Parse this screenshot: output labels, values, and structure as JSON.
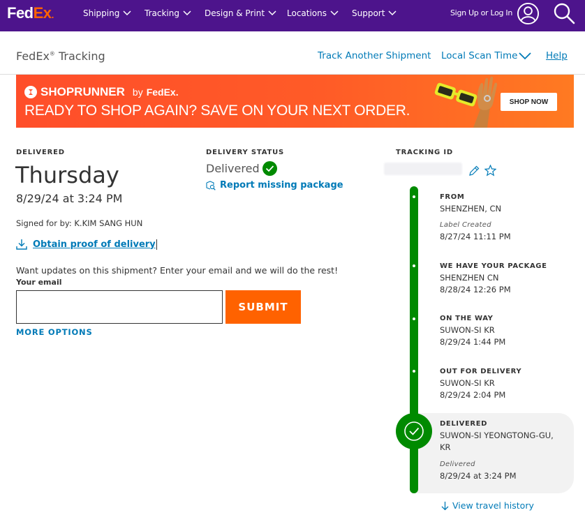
{
  "nav": {
    "logo_fed": "Fed",
    "logo_ex": "Ex",
    "items": [
      {
        "label": "Shipping"
      },
      {
        "label": "Tracking"
      },
      {
        "label": "Design & Print"
      },
      {
        "label": "Locations"
      },
      {
        "label": "Support"
      }
    ],
    "signup": "Sign Up or Log In"
  },
  "subheader": {
    "brand": "FedEx",
    "reg": "®",
    "page": "Tracking",
    "track_another": "Track Another Shipment",
    "local_scan_time": "Local Scan Time",
    "help": "Help"
  },
  "banner": {
    "brand": "SHOPRUNNER",
    "by": "by",
    "fedex": "FedEx.",
    "headline": "READY TO SHOP AGAIN? SAVE ON YOUR NEXT ORDER.",
    "cta": "SHOP NOW"
  },
  "delivered": {
    "label": "DELIVERED",
    "day": "Thursday",
    "datetime": "8/29/24 at 3:24 PM",
    "signed": "Signed for by: K.KIM SANG HUN",
    "proof": "Obtain proof of delivery"
  },
  "status": {
    "label": "DELIVERY STATUS",
    "value": "Delivered",
    "report": "Report missing package"
  },
  "updates": {
    "prompt": "Want updates on this shipment? Enter your email and we will do the rest!",
    "email_label": "Your email",
    "email_value": "",
    "submit": "SUBMIT",
    "more": "MORE OPTIONS"
  },
  "tracking": {
    "label": "TRACKING ID"
  },
  "timeline": {
    "events": [
      {
        "title": "FROM",
        "location": "SHENZHEN, CN",
        "note": "Label Created",
        "time": "8/27/24 11:11 PM"
      },
      {
        "title": "WE HAVE YOUR PACKAGE",
        "location": "SHENZHEN CN",
        "time": "8/28/24 12:26 PM"
      },
      {
        "title": "ON THE WAY",
        "location": "SUWON-SI KR",
        "time": "8/29/24 1:44 PM"
      },
      {
        "title": "OUT FOR DELIVERY",
        "location": "SUWON-SI KR",
        "time": "8/29/24 2:04 PM"
      },
      {
        "title": "DELIVERED",
        "location_line1": "SUWON-SI YEONGTONG-GU,",
        "location_line2": "KR",
        "note": "Delivered",
        "time": "8/29/24 at 3:24 PM"
      }
    ],
    "history": "View travel history"
  },
  "colors": {
    "fedex_purple": "#4d148c",
    "fedex_orange": "#ff6200",
    "link_blue": "#007ab7",
    "success_green": "#008a00"
  }
}
